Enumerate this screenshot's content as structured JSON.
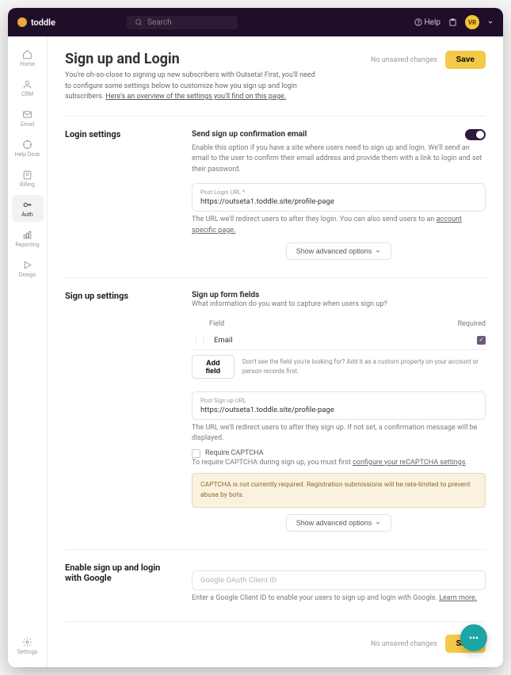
{
  "brand": "toddle",
  "search_placeholder": "Search",
  "top": {
    "help": "Help",
    "avatar": "VR"
  },
  "sidebar": {
    "items": [
      {
        "label": "Home"
      },
      {
        "label": "CRM"
      },
      {
        "label": "Email"
      },
      {
        "label": "Help Desk"
      },
      {
        "label": "Billing"
      },
      {
        "label": "Auth"
      },
      {
        "label": "Reporting"
      },
      {
        "label": "Design"
      }
    ],
    "footer": {
      "label": "Settings"
    }
  },
  "page": {
    "title": "Sign up and Login",
    "desc_1": "You're oh-so-close to signing up new subscribers with Outseta! First, you'll need to configure some settings below to customize how you sign up and login subscribers.",
    "desc_link": "Here's an overview of the settings you'll find on this page.",
    "unsaved": "No unsaved changes",
    "save": "Save"
  },
  "sections": {
    "login": {
      "title": "Login settings",
      "header": "Send sign up confirmation email",
      "help": "Enable this option if you have a site where users need to sign up and login. We'll send an email to the user to confirm their email address and provide them with a link to login and set their password.",
      "field_label": "Post Login URL *",
      "field_value": "https://outseta1.toddle.site/profile-page",
      "help2_a": "The URL we'll redirect users to after they login. You can also send users to an ",
      "help2_link": "account specific page.",
      "adv": "Show advanced options"
    },
    "signup": {
      "title": "Sign up settings",
      "header": "Sign up form fields",
      "help": "What information do you want to capture when users sign up?",
      "col_field": "Field",
      "col_req": "Required",
      "row1": "Email",
      "add_btn": "Add field",
      "add_help": "Don't see the field you're looking for? Add it as a custom property on your account or person records first.",
      "field2_label": "Post Sign up URL",
      "field2_value": "https://outseta1.toddle.site/profile-page",
      "help2": "The URL we'll redirect users to after they sign up. If not set, a confirmation message will be displayed.",
      "captcha_label": "Require CAPTCHA",
      "captcha_help_a": "To require CAPTCHA during sign up, you must first ",
      "captcha_help_link": "configure your reCAPTCHA settings",
      "warn": "CAPTCHA is not currently required. Registration submissions will be rate-limited to prevent abuse by bots.",
      "adv": "Show advanced options"
    },
    "google": {
      "title": "Enable sign up and login with Google",
      "field_placeholder": "Google OAuth Client ID",
      "help_a": "Enter a Google Client ID to enable your users to sign up and login with Google. ",
      "help_link": "Learn more."
    }
  }
}
